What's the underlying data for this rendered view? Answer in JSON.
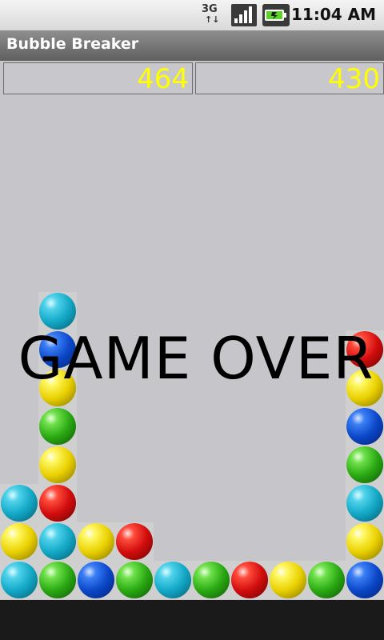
{
  "status": {
    "network_label": "3G",
    "time": "11:04 AM",
    "icons": [
      "3g-icon",
      "signal-icon",
      "battery-icon"
    ]
  },
  "app": {
    "title": "Bubble Breaker"
  },
  "scores": {
    "left": "464",
    "right": "430"
  },
  "overlay": {
    "text": "GAME OVER"
  },
  "colors": {
    "score_text": "#ffff00",
    "board_background": "#c6c5c9"
  },
  "board": {
    "columns": 10,
    "bubbles": [
      {
        "col": 1,
        "row": 7,
        "color": "cyan"
      },
      {
        "col": 1,
        "row": 6,
        "color": "blue"
      },
      {
        "col": 1,
        "row": 5,
        "color": "yellow"
      },
      {
        "col": 1,
        "row": 4,
        "color": "green"
      },
      {
        "col": 1,
        "row": 3,
        "color": "yellow"
      },
      {
        "col": 1,
        "row": 2,
        "color": "red"
      },
      {
        "col": 1,
        "row": 1,
        "color": "cyan"
      },
      {
        "col": 1,
        "row": 0,
        "color": "green"
      },
      {
        "col": 0,
        "row": 2,
        "color": "cyan"
      },
      {
        "col": 0,
        "row": 1,
        "color": "yellow"
      },
      {
        "col": 0,
        "row": 0,
        "color": "cyan"
      },
      {
        "col": 2,
        "row": 1,
        "color": "yellow"
      },
      {
        "col": 2,
        "row": 0,
        "color": "blue"
      },
      {
        "col": 3,
        "row": 1,
        "color": "red"
      },
      {
        "col": 3,
        "row": 0,
        "color": "green"
      },
      {
        "col": 4,
        "row": 0,
        "color": "cyan"
      },
      {
        "col": 5,
        "row": 0,
        "color": "green"
      },
      {
        "col": 6,
        "row": 0,
        "color": "red"
      },
      {
        "col": 7,
        "row": 0,
        "color": "yellow"
      },
      {
        "col": 8,
        "row": 0,
        "color": "green"
      },
      {
        "col": 9,
        "row": 6,
        "color": "red"
      },
      {
        "col": 9,
        "row": 5,
        "color": "yellow"
      },
      {
        "col": 9,
        "row": 4,
        "color": "blue"
      },
      {
        "col": 9,
        "row": 3,
        "color": "green"
      },
      {
        "col": 9,
        "row": 2,
        "color": "cyan"
      },
      {
        "col": 9,
        "row": 1,
        "color": "yellow"
      },
      {
        "col": 9,
        "row": 0,
        "color": "blue"
      }
    ]
  }
}
